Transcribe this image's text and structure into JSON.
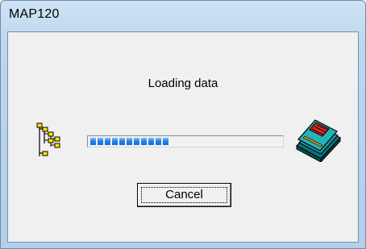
{
  "window": {
    "title": "MAP120"
  },
  "dialog": {
    "message": "Loading data",
    "progress": {
      "filled_chunks": 11,
      "fraction": 0.42
    },
    "cancel_label": "Cancel",
    "icons": {
      "left": "tree-structure-icon",
      "right": "book-icon"
    }
  }
}
